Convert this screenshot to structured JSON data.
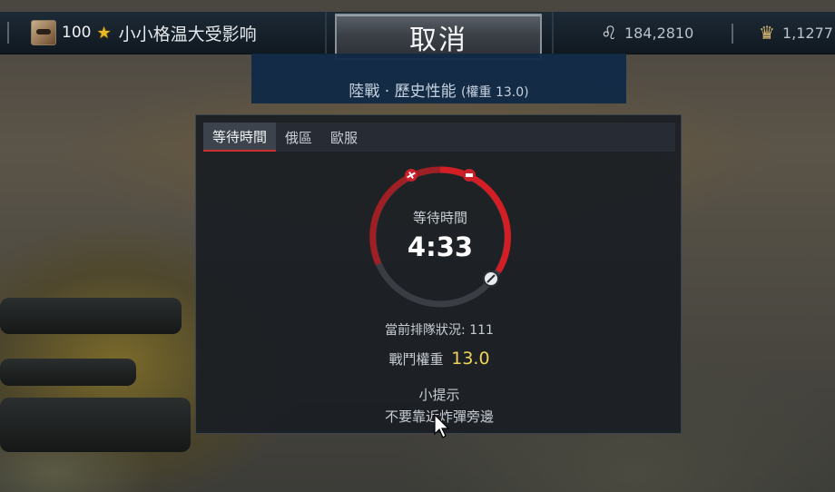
{
  "player": {
    "level": "100",
    "name": "小小格温大受影响"
  },
  "cancel_button": "取消",
  "currency": {
    "silver_lions": "184,2810",
    "golden_eagles": "1,1277"
  },
  "mode": {
    "title": "陸戰 · 歷史性能",
    "br": "(權重 13.0)"
  },
  "tabs": [
    "等待時間",
    "俄區",
    "歐服"
  ],
  "queue": {
    "wait_label": "等待時間",
    "wait_time": "4:33",
    "status_label": "當前排隊狀況:",
    "status_value": "111",
    "battle_rating_label": "戰鬥權重",
    "battle_rating_value": "13.0",
    "hint_title": "小提示",
    "hint_text": "不要靠近炸彈旁邊"
  },
  "colors": {
    "ring_active": "#d21e24",
    "battle_rating": "#f1d35a",
    "banner": "#0e2846"
  },
  "icons": [
    "avatar",
    "star-icon",
    "silver-lion-icon",
    "golden-eagle-icon",
    "plane-icon",
    "tank-icon",
    "compass-icon",
    "mouse-cursor-icon"
  ]
}
